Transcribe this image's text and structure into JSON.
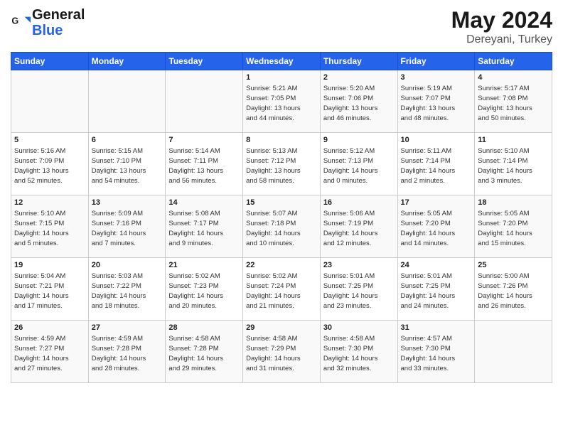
{
  "logo": {
    "line1": "General",
    "line2": "Blue"
  },
  "title": {
    "month_year": "May 2024",
    "location": "Dereyani, Turkey"
  },
  "weekdays": [
    "Sunday",
    "Monday",
    "Tuesday",
    "Wednesday",
    "Thursday",
    "Friday",
    "Saturday"
  ],
  "weeks": [
    [
      {
        "day": "",
        "info": ""
      },
      {
        "day": "",
        "info": ""
      },
      {
        "day": "",
        "info": ""
      },
      {
        "day": "1",
        "info": "Sunrise: 5:21 AM\nSunset: 7:05 PM\nDaylight: 13 hours\nand 44 minutes."
      },
      {
        "day": "2",
        "info": "Sunrise: 5:20 AM\nSunset: 7:06 PM\nDaylight: 13 hours\nand 46 minutes."
      },
      {
        "day": "3",
        "info": "Sunrise: 5:19 AM\nSunset: 7:07 PM\nDaylight: 13 hours\nand 48 minutes."
      },
      {
        "day": "4",
        "info": "Sunrise: 5:17 AM\nSunset: 7:08 PM\nDaylight: 13 hours\nand 50 minutes."
      }
    ],
    [
      {
        "day": "5",
        "info": "Sunrise: 5:16 AM\nSunset: 7:09 PM\nDaylight: 13 hours\nand 52 minutes."
      },
      {
        "day": "6",
        "info": "Sunrise: 5:15 AM\nSunset: 7:10 PM\nDaylight: 13 hours\nand 54 minutes."
      },
      {
        "day": "7",
        "info": "Sunrise: 5:14 AM\nSunset: 7:11 PM\nDaylight: 13 hours\nand 56 minutes."
      },
      {
        "day": "8",
        "info": "Sunrise: 5:13 AM\nSunset: 7:12 PM\nDaylight: 13 hours\nand 58 minutes."
      },
      {
        "day": "9",
        "info": "Sunrise: 5:12 AM\nSunset: 7:13 PM\nDaylight: 14 hours\nand 0 minutes."
      },
      {
        "day": "10",
        "info": "Sunrise: 5:11 AM\nSunset: 7:14 PM\nDaylight: 14 hours\nand 2 minutes."
      },
      {
        "day": "11",
        "info": "Sunrise: 5:10 AM\nSunset: 7:14 PM\nDaylight: 14 hours\nand 3 minutes."
      }
    ],
    [
      {
        "day": "12",
        "info": "Sunrise: 5:10 AM\nSunset: 7:15 PM\nDaylight: 14 hours\nand 5 minutes."
      },
      {
        "day": "13",
        "info": "Sunrise: 5:09 AM\nSunset: 7:16 PM\nDaylight: 14 hours\nand 7 minutes."
      },
      {
        "day": "14",
        "info": "Sunrise: 5:08 AM\nSunset: 7:17 PM\nDaylight: 14 hours\nand 9 minutes."
      },
      {
        "day": "15",
        "info": "Sunrise: 5:07 AM\nSunset: 7:18 PM\nDaylight: 14 hours\nand 10 minutes."
      },
      {
        "day": "16",
        "info": "Sunrise: 5:06 AM\nSunset: 7:19 PM\nDaylight: 14 hours\nand 12 minutes."
      },
      {
        "day": "17",
        "info": "Sunrise: 5:05 AM\nSunset: 7:20 PM\nDaylight: 14 hours\nand 14 minutes."
      },
      {
        "day": "18",
        "info": "Sunrise: 5:05 AM\nSunset: 7:20 PM\nDaylight: 14 hours\nand 15 minutes."
      }
    ],
    [
      {
        "day": "19",
        "info": "Sunrise: 5:04 AM\nSunset: 7:21 PM\nDaylight: 14 hours\nand 17 minutes."
      },
      {
        "day": "20",
        "info": "Sunrise: 5:03 AM\nSunset: 7:22 PM\nDaylight: 14 hours\nand 18 minutes."
      },
      {
        "day": "21",
        "info": "Sunrise: 5:02 AM\nSunset: 7:23 PM\nDaylight: 14 hours\nand 20 minutes."
      },
      {
        "day": "22",
        "info": "Sunrise: 5:02 AM\nSunset: 7:24 PM\nDaylight: 14 hours\nand 21 minutes."
      },
      {
        "day": "23",
        "info": "Sunrise: 5:01 AM\nSunset: 7:25 PM\nDaylight: 14 hours\nand 23 minutes."
      },
      {
        "day": "24",
        "info": "Sunrise: 5:01 AM\nSunset: 7:25 PM\nDaylight: 14 hours\nand 24 minutes."
      },
      {
        "day": "25",
        "info": "Sunrise: 5:00 AM\nSunset: 7:26 PM\nDaylight: 14 hours\nand 26 minutes."
      }
    ],
    [
      {
        "day": "26",
        "info": "Sunrise: 4:59 AM\nSunset: 7:27 PM\nDaylight: 14 hours\nand 27 minutes."
      },
      {
        "day": "27",
        "info": "Sunrise: 4:59 AM\nSunset: 7:28 PM\nDaylight: 14 hours\nand 28 minutes."
      },
      {
        "day": "28",
        "info": "Sunrise: 4:58 AM\nSunset: 7:28 PM\nDaylight: 14 hours\nand 29 minutes."
      },
      {
        "day": "29",
        "info": "Sunrise: 4:58 AM\nSunset: 7:29 PM\nDaylight: 14 hours\nand 31 minutes."
      },
      {
        "day": "30",
        "info": "Sunrise: 4:58 AM\nSunset: 7:30 PM\nDaylight: 14 hours\nand 32 minutes."
      },
      {
        "day": "31",
        "info": "Sunrise: 4:57 AM\nSunset: 7:30 PM\nDaylight: 14 hours\nand 33 minutes."
      },
      {
        "day": "",
        "info": ""
      }
    ]
  ]
}
